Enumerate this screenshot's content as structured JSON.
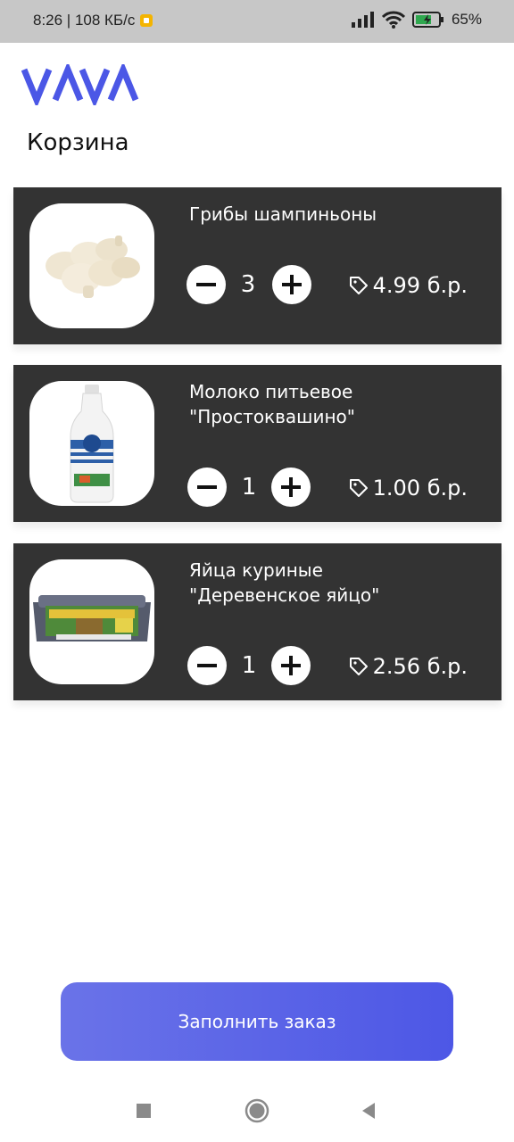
{
  "status_bar": {
    "left_text": "8:26 | 108 КБ/с",
    "battery": "65%"
  },
  "logo_text": "VAAV",
  "header": {
    "title": "Корзина"
  },
  "cart": {
    "items": [
      {
        "name": "Грибы шампиньоны",
        "quantity": "3",
        "price": "4.99 б.р.",
        "image": "mushrooms-image"
      },
      {
        "name": "Молоко питьевое\n\"Простоквашино\"",
        "quantity": "1",
        "price": "1.00 б.р.",
        "image": "milk-bottle-image"
      },
      {
        "name": "Яйца куриные\n\"Деревенское яйцо\"",
        "quantity": "1",
        "price": "2.56 б.р.",
        "image": "egg-carton-image"
      }
    ]
  },
  "cta": {
    "label": "Заполнить заказ"
  },
  "colors": {
    "accent": "#5a64e8",
    "card": "#333333",
    "status_bar": "#c7c7c7"
  },
  "icons": [
    "minus-icon",
    "plus-icon",
    "price-tag-icon",
    "wifi-icon",
    "signal-icon",
    "battery-icon",
    "recents-icon",
    "home-icon",
    "back-icon"
  ]
}
